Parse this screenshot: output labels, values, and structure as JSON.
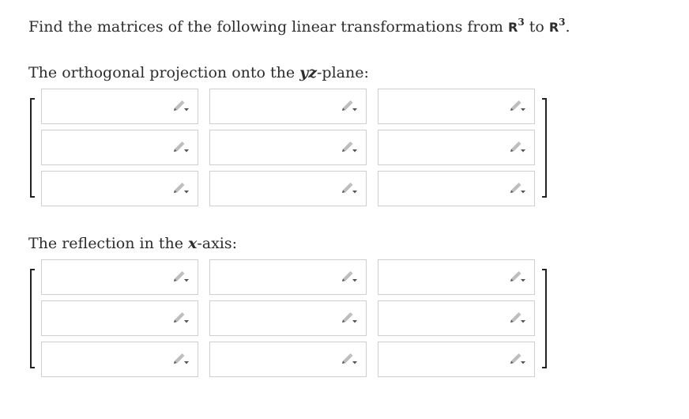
{
  "question": {
    "title_prefix": "Find the matrices of the following linear transformations from ",
    "space_symbol": "R",
    "exponent": "3",
    "to_word": " to ",
    "period": ".",
    "part1": {
      "label_prefix": "The orthogonal projection onto the ",
      "label_var": "yz",
      "label_suffix": "-plane:"
    },
    "part2": {
      "label_prefix": "The reflection in the ",
      "label_var": "x",
      "label_suffix": "-axis:"
    }
  },
  "matrices": [
    {
      "rows": [
        [
          "",
          "",
          ""
        ],
        [
          "",
          "",
          ""
        ],
        [
          "",
          "",
          ""
        ]
      ]
    },
    {
      "rows": [
        [
          "",
          "",
          ""
        ],
        [
          "",
          "",
          ""
        ],
        [
          "",
          "",
          ""
        ]
      ]
    }
  ],
  "icons": {
    "cell_icon": "pencil-dropdown-icon"
  },
  "colors": {
    "text": "#2d2d2d",
    "cell_border": "#cfcfcf",
    "icon_gray": "#bdbdbd",
    "icon_dark": "#555555"
  }
}
